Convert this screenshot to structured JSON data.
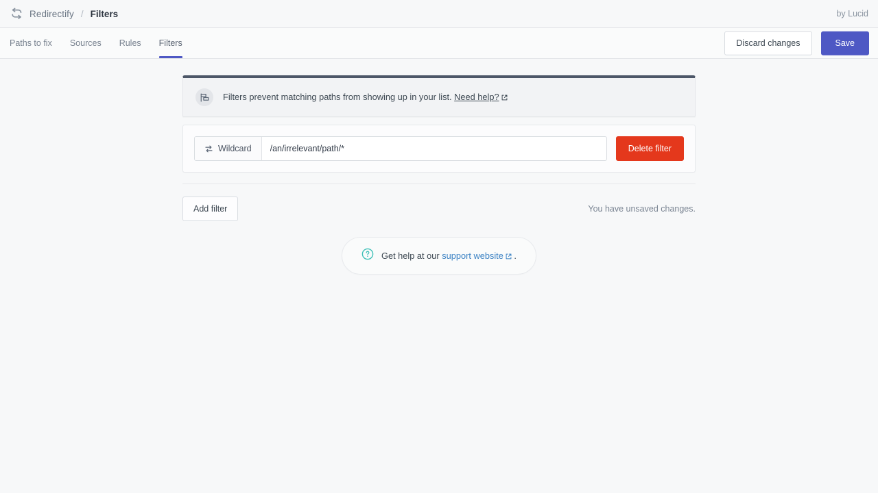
{
  "header": {
    "logo_icon": "redirect-loop-icon",
    "brand": "Redirectify",
    "separator": "/",
    "current_page": "Filters",
    "byline": "by Lucid"
  },
  "nav": {
    "tabs": [
      {
        "label": "Paths to fix",
        "active": false
      },
      {
        "label": "Sources",
        "active": false
      },
      {
        "label": "Rules",
        "active": false
      },
      {
        "label": "Filters",
        "active": true
      }
    ],
    "discard_label": "Discard changes",
    "save_label": "Save",
    "active_underline_color": "#4e58c4",
    "save_color": "#4e58c4"
  },
  "banner": {
    "icon": "filter-flag-icon",
    "text": "Filters prevent matching paths from showing up in your list.",
    "link_label": "Need help?",
    "link_icon": "external-link-icon",
    "accent_color": "#4d5768"
  },
  "filter": {
    "type_icon": "swap-arrows-icon",
    "type_label": "Wildcard",
    "path_value": "/an/irrelevant/path/*",
    "path_placeholder": "/an/irrelevant/path/*",
    "delete_label": "Delete filter",
    "delete_color": "#e4381c"
  },
  "footer": {
    "add_label": "Add filter",
    "status": "You have unsaved changes."
  },
  "help": {
    "icon": "question-circle-icon",
    "icon_color": "#3fc0b8",
    "text_before": "Get help at our",
    "link_label": "support website",
    "link_icon": "external-link-icon",
    "text_after": ".",
    "link_color": "#3b82c4"
  }
}
